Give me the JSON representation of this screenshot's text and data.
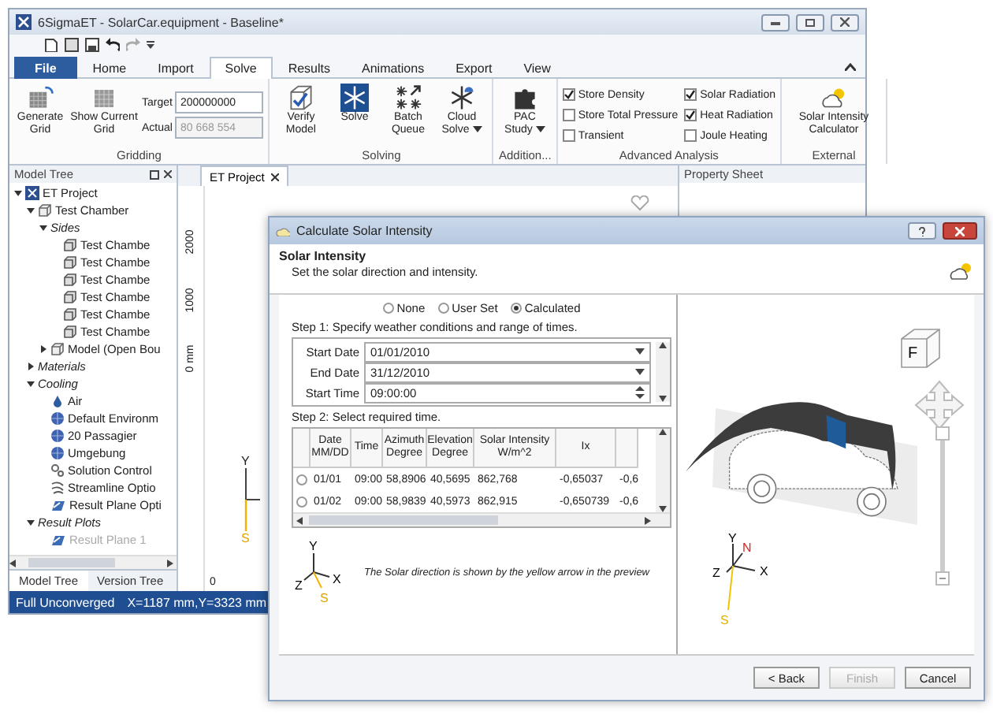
{
  "main_window": {
    "title": "6SigmaET - SolarCar.equipment - Baseline*",
    "ribbon_tabs": [
      {
        "label": "File",
        "kind": "file",
        "selected": false
      },
      {
        "label": "Home",
        "kind": "tab",
        "selected": false
      },
      {
        "label": "Import",
        "kind": "tab",
        "selected": false
      },
      {
        "label": "Solve",
        "kind": "tab",
        "selected": true
      },
      {
        "label": "Results",
        "kind": "tab",
        "selected": false
      },
      {
        "label": "Animations",
        "kind": "tab",
        "selected": false
      },
      {
        "label": "Export",
        "kind": "tab",
        "selected": false
      },
      {
        "label": "View",
        "kind": "tab",
        "selected": false
      }
    ],
    "gridding": {
      "label": "Gridding",
      "buttons": [
        "Generate Grid",
        "Show Current Grid"
      ],
      "target_label": "Target",
      "target_value": "200000000",
      "actual_label": "Actual",
      "actual_value": "80 668 554"
    },
    "solving": {
      "label": "Solving",
      "buttons": [
        {
          "label": "Verify Model",
          "dropdown": false,
          "selected": false
        },
        {
          "label": "Solve",
          "dropdown": false,
          "selected": true
        },
        {
          "label": "Batch Queue",
          "dropdown": false,
          "selected": false
        },
        {
          "label": "Cloud Solve",
          "dropdown": true,
          "selected": false
        }
      ]
    },
    "addition": {
      "label": "Addition...",
      "buttons": [
        {
          "label": "PAC Study",
          "dropdown": true
        }
      ]
    },
    "advanced_analysis": {
      "label": "Advanced Analysis",
      "options": [
        {
          "label": "Store Density",
          "checked": true
        },
        {
          "label": "Store Total Pressure",
          "checked": false
        },
        {
          "label": "Transient",
          "checked": false
        },
        {
          "label": "Solar Radiation",
          "checked": true
        },
        {
          "label": "Heat Radiation",
          "checked": true
        },
        {
          "label": "Joule Heating",
          "checked": false
        }
      ]
    },
    "external": {
      "label": "External",
      "button": "Solar Intensity Calculator"
    },
    "model_tree": {
      "title": "Model Tree",
      "items": [
        {
          "label": "ET Project",
          "kind": "project",
          "expanded": true,
          "disabled": false,
          "children": [
            {
              "label": "Test Chamber",
              "kind": "assembly",
              "expanded": true,
              "disabled": false,
              "children": [
                {
                  "label": "Sides",
                  "kind": "folder",
                  "expanded": true,
                  "disabled": false,
                  "children": [
                    {
                      "label": "Test Chambe",
                      "kind": "part",
                      "disabled": false
                    },
                    {
                      "label": "Test Chambe",
                      "kind": "part",
                      "disabled": false
                    },
                    {
                      "label": "Test Chambe",
                      "kind": "part",
                      "disabled": false
                    },
                    {
                      "label": "Test Chambe",
                      "kind": "part",
                      "disabled": false
                    },
                    {
                      "label": "Test Chambe",
                      "kind": "part",
                      "disabled": false
                    },
                    {
                      "label": "Test Chambe",
                      "kind": "part",
                      "disabled": false
                    }
                  ]
                },
                {
                  "label": "Model (Open Bou",
                  "kind": "assembly",
                  "expanded": false,
                  "disabled": false
                }
              ]
            },
            {
              "label": "Materials",
              "kind": "folder",
              "expanded": false,
              "disabled": false
            },
            {
              "label": "Cooling",
              "kind": "folder",
              "expanded": true,
              "disabled": false,
              "children": [
                {
                  "label": "Air",
                  "kind": "fluid",
                  "disabled": false
                },
                {
                  "label": "Default Environm",
                  "kind": "environment",
                  "disabled": false
                },
                {
                  "label": "20 Passagier",
                  "kind": "environment",
                  "disabled": false
                },
                {
                  "label": "Umgebung",
                  "kind": "environment",
                  "disabled": false
                },
                {
                  "label": "Solution Control",
                  "kind": "settings",
                  "disabled": false
                },
                {
                  "label": "Streamline Optio",
                  "kind": "streamline",
                  "disabled": false
                },
                {
                  "label": "Result Plane Opti",
                  "kind": "plane",
                  "disabled": false
                }
              ]
            },
            {
              "label": "Result Plots",
              "kind": "folder",
              "expanded": true,
              "disabled": false,
              "children": [
                {
                  "label": "Result Plane 1",
                  "kind": "plane",
                  "disabled": true
                }
              ]
            }
          ]
        }
      ]
    },
    "bottom_tabs": [
      {
        "label": "Model Tree",
        "selected": true
      },
      {
        "label": "Version Tree",
        "selected": false
      }
    ],
    "document_tabs": [
      {
        "label": "ET Project",
        "selected": true
      }
    ],
    "ruler_labels": [
      "2000",
      "1000",
      "0 mm"
    ],
    "canvas_axis": {
      "y": "Y",
      "s": "S",
      "origin": "0"
    },
    "property_sheet": {
      "title": "Property Sheet"
    },
    "status_bar": {
      "state": "Full Unconverged",
      "coordinates": "X=1187 mm,Y=3323 mm"
    }
  },
  "dialog": {
    "title": "Calculate Solar Intensity",
    "heading": "Solar Intensity",
    "subtitle": "Set the solar direction and intensity.",
    "modes": [
      {
        "label": "None",
        "selected": false
      },
      {
        "label": "User Set",
        "selected": false
      },
      {
        "label": "Calculated",
        "selected": true
      }
    ],
    "step1": "Step 1: Specify weather conditions and range of times.",
    "fields": [
      {
        "label": "Start Date",
        "value": "01/01/2010",
        "kind": "date"
      },
      {
        "label": "End Date",
        "value": "31/12/2010",
        "kind": "date"
      },
      {
        "label": "Start Time",
        "value": "09:00:00",
        "kind": "time"
      }
    ],
    "step2": "Step 2: Select required time.",
    "table": {
      "columns": [
        "Date MM/DD",
        "Time",
        "Azimuth Degree",
        "Elevation Degree",
        "Solar Intensity W/m^2",
        "Ix"
      ],
      "rows": [
        {
          "selected": false,
          "cells": [
            "01/01",
            "09:00",
            "58,8906",
            "40,5695",
            "862,768",
            "-0,65037",
            "-0,6"
          ]
        },
        {
          "selected": false,
          "cells": [
            "01/02",
            "09:00",
            "58,9839",
            "40,5973",
            "862,915",
            "-0,650739",
            "-0,6"
          ]
        }
      ]
    },
    "axis_labels": {
      "y": "Y",
      "x": "X",
      "z": "Z",
      "s": "S"
    },
    "note": "The Solar direction is shown by the yellow arrow in the preview",
    "preview": {
      "cube_label": "F",
      "axes": {
        "y": "Y",
        "n": "N",
        "x": "X",
        "z": "Z",
        "s": "S"
      }
    },
    "buttons": [
      {
        "label": "< Back",
        "disabled": false
      },
      {
        "label": "Finish",
        "disabled": true
      },
      {
        "label": "Cancel",
        "disabled": false
      }
    ]
  }
}
